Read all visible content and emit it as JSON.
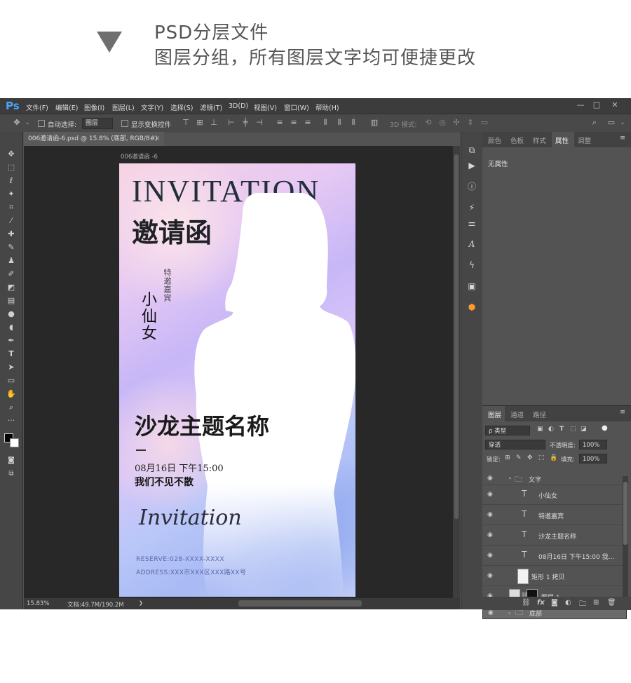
{
  "header": {
    "line1": "PSD分层文件",
    "line2": "图层分组，所有图层文字均可便捷更改"
  },
  "app": {
    "logo": "Ps",
    "menu": [
      "文件(F)",
      "编辑(E)",
      "图像(I)",
      "图层(L)",
      "文字(Y)",
      "选择(S)",
      "滤镜(T)",
      "3D(D)",
      "视图(V)",
      "窗口(W)",
      "帮助(H)"
    ],
    "window_buttons": [
      "—",
      "□",
      "✕"
    ]
  },
  "options": {
    "auto_select_label": "自动选择:",
    "auto_select_value": "图层",
    "show_transform_label": "显示变换控件",
    "mode3d_label": "3D 模式:"
  },
  "document": {
    "tab_title": "006邀请函-6.psd @ 15.8% (底部, RGB/8#)",
    "close": "×",
    "artboard_label": "006邀请函 -6"
  },
  "artwork": {
    "invitation": "INVITATION",
    "yaoqinghan": "邀请函",
    "teyaojiabin": "特邀嘉宾",
    "guest": "小仙女",
    "salon": "沙龙主题名称",
    "date": "08月16日 下午15:00",
    "motto": "我们不见不散",
    "script": "Invitation",
    "reserve": "RESERVE:028-XXXX-XXXX",
    "address": "ADDRESS:XXX市XXX区XXX路XX号"
  },
  "status": {
    "zoom": "15.83%",
    "doc_info": "文档:49.7M/190.2M",
    "arrow": "❯"
  },
  "properties_panel": {
    "tabs": [
      "颜色",
      "色板",
      "样式",
      "属性",
      "调整"
    ],
    "active_tab": "属性",
    "content": "无属性"
  },
  "layers_panel": {
    "tabs": [
      "图层",
      "通道",
      "路径"
    ],
    "active_tab": "图层",
    "filter_kind": "ρ 类型",
    "blend_mode": "穿透",
    "opacity_label": "不透明度:",
    "opacity_value": "100%",
    "lock_label": "锁定:",
    "fill_label": "填充:",
    "fill_value": "100%",
    "layers": [
      {
        "name": "文字",
        "type": "group",
        "expanded": true
      },
      {
        "name": "小仙女",
        "type": "text"
      },
      {
        "name": "特邀嘉宾",
        "type": "text"
      },
      {
        "name": "沙龙主题名称",
        "type": "text"
      },
      {
        "name": "08月16日 下午15:00 我...",
        "type": "text"
      },
      {
        "name": "矩形 1 拷贝",
        "type": "shape"
      },
      {
        "name": "图层 1",
        "type": "pixel"
      },
      {
        "name": "底部",
        "type": "group",
        "expanded": false,
        "selected": true
      }
    ]
  }
}
